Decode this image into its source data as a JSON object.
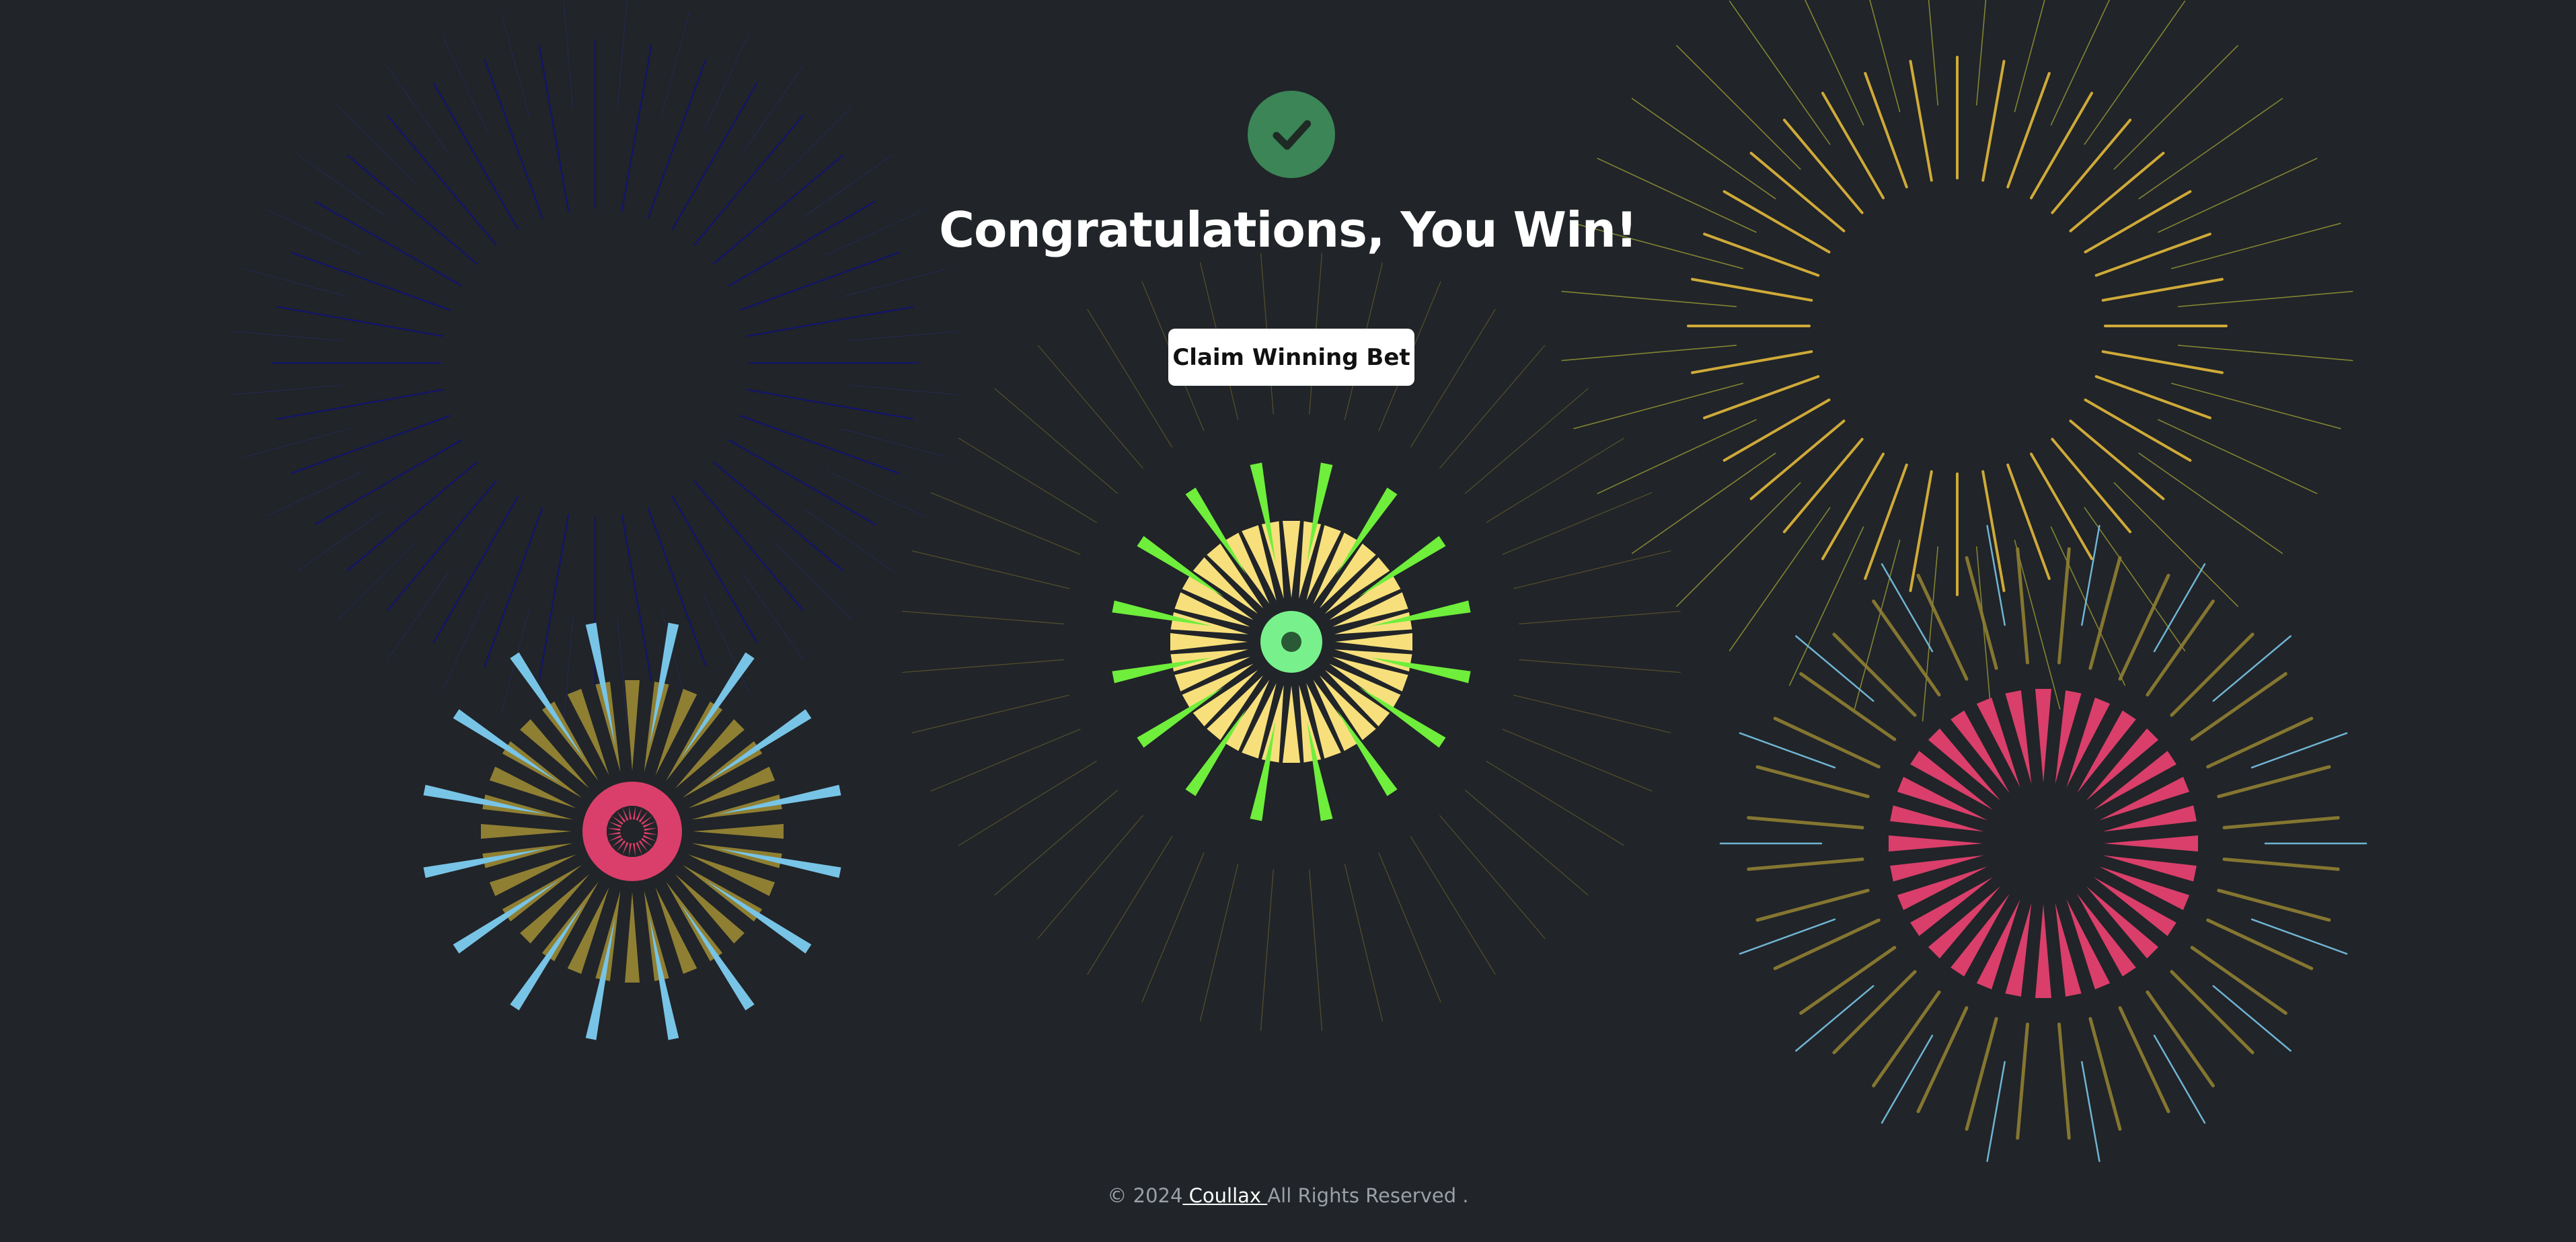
{
  "page": {
    "title": "Congratulations, You Win!",
    "claim_button_label": "Claim Winning Bet",
    "status_icon": "check-icon"
  },
  "footer": {
    "copyright_prefix": "© 2024",
    "brand_link": " Coullax ",
    "rights_text": "All Rights Reserved ."
  },
  "colors": {
    "background": "#212428",
    "success_badge": "#3b8556",
    "button_bg": "#ffffff",
    "firework_navy": "#10127a",
    "firework_gold": "#e2b93b",
    "firework_olive": "#8f7f33",
    "firework_green": "#6fee3c",
    "firework_pale_yellow": "#f7e07c",
    "firework_mint": "#78f18c",
    "firework_sky": "#78c4e6",
    "firework_pink": "#d93f6a"
  }
}
